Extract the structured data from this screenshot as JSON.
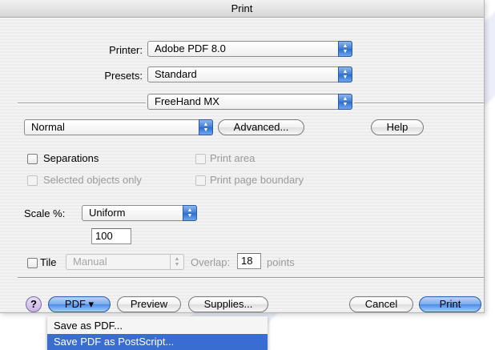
{
  "window": {
    "title": "Print"
  },
  "printer": {
    "label": "Printer:",
    "value": "Adobe PDF 8.0"
  },
  "presets": {
    "label": "Presets:",
    "value": "Standard"
  },
  "pane_selector": {
    "value": "FreeHand MX"
  },
  "settings": {
    "mode": "Normal",
    "advanced_label": "Advanced...",
    "help_label": "Help"
  },
  "options": {
    "separations": "Separations",
    "print_area": "Print area",
    "selected_objects_only": "Selected objects only",
    "print_page_boundary": "Print page boundary"
  },
  "scale": {
    "label": "Scale %:",
    "mode": "Uniform",
    "value": "100"
  },
  "tile": {
    "label": "Tile",
    "mode": "Manual",
    "overlap_label": "Overlap:",
    "overlap_value": "18",
    "units": "points"
  },
  "footer": {
    "help_symbol": "?",
    "pdf_label": "PDF ▾",
    "preview_label": "Preview",
    "supplies_label": "Supplies...",
    "cancel_label": "Cancel",
    "print_label": "Print"
  },
  "pdf_menu": {
    "items": [
      "Save as PDF...",
      "Save PDF as PostScript..."
    ],
    "selected_index": 1
  },
  "colors": {
    "accent": "#3a6dd1",
    "button_blue": "#4b8be6"
  },
  "icons": [
    "popup-arrows-icon",
    "help-question-icon",
    "checkbox-icon"
  ]
}
